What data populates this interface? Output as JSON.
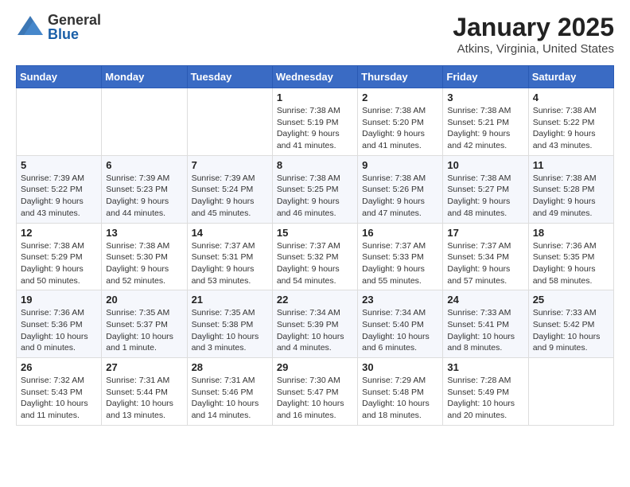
{
  "header": {
    "logo_general": "General",
    "logo_blue": "Blue",
    "month_title": "January 2025",
    "location": "Atkins, Virginia, United States"
  },
  "days_of_week": [
    "Sunday",
    "Monday",
    "Tuesday",
    "Wednesday",
    "Thursday",
    "Friday",
    "Saturday"
  ],
  "weeks": [
    {
      "days": [
        {
          "num": "",
          "info": ""
        },
        {
          "num": "",
          "info": ""
        },
        {
          "num": "",
          "info": ""
        },
        {
          "num": "1",
          "info": "Sunrise: 7:38 AM\nSunset: 5:19 PM\nDaylight: 9 hours and 41 minutes."
        },
        {
          "num": "2",
          "info": "Sunrise: 7:38 AM\nSunset: 5:20 PM\nDaylight: 9 hours and 41 minutes."
        },
        {
          "num": "3",
          "info": "Sunrise: 7:38 AM\nSunset: 5:21 PM\nDaylight: 9 hours and 42 minutes."
        },
        {
          "num": "4",
          "info": "Sunrise: 7:38 AM\nSunset: 5:22 PM\nDaylight: 9 hours and 43 minutes."
        }
      ]
    },
    {
      "days": [
        {
          "num": "5",
          "info": "Sunrise: 7:39 AM\nSunset: 5:22 PM\nDaylight: 9 hours and 43 minutes."
        },
        {
          "num": "6",
          "info": "Sunrise: 7:39 AM\nSunset: 5:23 PM\nDaylight: 9 hours and 44 minutes."
        },
        {
          "num": "7",
          "info": "Sunrise: 7:39 AM\nSunset: 5:24 PM\nDaylight: 9 hours and 45 minutes."
        },
        {
          "num": "8",
          "info": "Sunrise: 7:38 AM\nSunset: 5:25 PM\nDaylight: 9 hours and 46 minutes."
        },
        {
          "num": "9",
          "info": "Sunrise: 7:38 AM\nSunset: 5:26 PM\nDaylight: 9 hours and 47 minutes."
        },
        {
          "num": "10",
          "info": "Sunrise: 7:38 AM\nSunset: 5:27 PM\nDaylight: 9 hours and 48 minutes."
        },
        {
          "num": "11",
          "info": "Sunrise: 7:38 AM\nSunset: 5:28 PM\nDaylight: 9 hours and 49 minutes."
        }
      ]
    },
    {
      "days": [
        {
          "num": "12",
          "info": "Sunrise: 7:38 AM\nSunset: 5:29 PM\nDaylight: 9 hours and 50 minutes."
        },
        {
          "num": "13",
          "info": "Sunrise: 7:38 AM\nSunset: 5:30 PM\nDaylight: 9 hours and 52 minutes."
        },
        {
          "num": "14",
          "info": "Sunrise: 7:37 AM\nSunset: 5:31 PM\nDaylight: 9 hours and 53 minutes."
        },
        {
          "num": "15",
          "info": "Sunrise: 7:37 AM\nSunset: 5:32 PM\nDaylight: 9 hours and 54 minutes."
        },
        {
          "num": "16",
          "info": "Sunrise: 7:37 AM\nSunset: 5:33 PM\nDaylight: 9 hours and 55 minutes."
        },
        {
          "num": "17",
          "info": "Sunrise: 7:37 AM\nSunset: 5:34 PM\nDaylight: 9 hours and 57 minutes."
        },
        {
          "num": "18",
          "info": "Sunrise: 7:36 AM\nSunset: 5:35 PM\nDaylight: 9 hours and 58 minutes."
        }
      ]
    },
    {
      "days": [
        {
          "num": "19",
          "info": "Sunrise: 7:36 AM\nSunset: 5:36 PM\nDaylight: 10 hours and 0 minutes."
        },
        {
          "num": "20",
          "info": "Sunrise: 7:35 AM\nSunset: 5:37 PM\nDaylight: 10 hours and 1 minute."
        },
        {
          "num": "21",
          "info": "Sunrise: 7:35 AM\nSunset: 5:38 PM\nDaylight: 10 hours and 3 minutes."
        },
        {
          "num": "22",
          "info": "Sunrise: 7:34 AM\nSunset: 5:39 PM\nDaylight: 10 hours and 4 minutes."
        },
        {
          "num": "23",
          "info": "Sunrise: 7:34 AM\nSunset: 5:40 PM\nDaylight: 10 hours and 6 minutes."
        },
        {
          "num": "24",
          "info": "Sunrise: 7:33 AM\nSunset: 5:41 PM\nDaylight: 10 hours and 8 minutes."
        },
        {
          "num": "25",
          "info": "Sunrise: 7:33 AM\nSunset: 5:42 PM\nDaylight: 10 hours and 9 minutes."
        }
      ]
    },
    {
      "days": [
        {
          "num": "26",
          "info": "Sunrise: 7:32 AM\nSunset: 5:43 PM\nDaylight: 10 hours and 11 minutes."
        },
        {
          "num": "27",
          "info": "Sunrise: 7:31 AM\nSunset: 5:44 PM\nDaylight: 10 hours and 13 minutes."
        },
        {
          "num": "28",
          "info": "Sunrise: 7:31 AM\nSunset: 5:46 PM\nDaylight: 10 hours and 14 minutes."
        },
        {
          "num": "29",
          "info": "Sunrise: 7:30 AM\nSunset: 5:47 PM\nDaylight: 10 hours and 16 minutes."
        },
        {
          "num": "30",
          "info": "Sunrise: 7:29 AM\nSunset: 5:48 PM\nDaylight: 10 hours and 18 minutes."
        },
        {
          "num": "31",
          "info": "Sunrise: 7:28 AM\nSunset: 5:49 PM\nDaylight: 10 hours and 20 minutes."
        },
        {
          "num": "",
          "info": ""
        }
      ]
    }
  ]
}
